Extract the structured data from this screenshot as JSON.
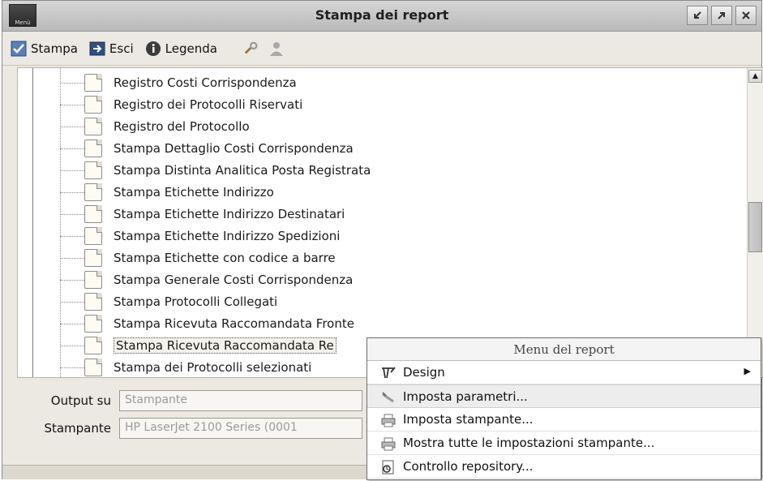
{
  "window": {
    "title": "Stampa dei report",
    "app_icon_text": "Menù",
    "controls": [
      "minimize-icon",
      "maximize-icon",
      "close-icon"
    ]
  },
  "toolbar": {
    "stampa_label": "Stampa",
    "esci_label": "Esci",
    "legenda_label": "Legenda"
  },
  "tree": {
    "items": [
      {
        "label": "Registro Costi Corrispondenza"
      },
      {
        "label": "Registro dei Protocolli Riservati"
      },
      {
        "label": "Registro del Protocollo"
      },
      {
        "label": "Stampa Dettaglio Costi Corrispondenza"
      },
      {
        "label": "Stampa Distinta Analitica Posta Registrata"
      },
      {
        "label": "Stampa Etichette Indirizzo"
      },
      {
        "label": "Stampa Etichette Indirizzo Destinatari"
      },
      {
        "label": "Stampa Etichette Indirizzo Spedizioni"
      },
      {
        "label": "Stampa Etichette con codice a barre"
      },
      {
        "label": "Stampa Generale Costi Corrispondenza"
      },
      {
        "label": "Stampa Protocolli Collegati"
      },
      {
        "label": "Stampa Ricevuta Raccomandata Fronte"
      },
      {
        "label": "Stampa Ricevuta Raccomandata Re"
      },
      {
        "label": "Stampa dei Protocolli selezionati"
      }
    ],
    "selected_index": 12
  },
  "form": {
    "output_label": "Output su",
    "output_value": "Stampante",
    "printer_label": "Stampante",
    "printer_value": "HP LaserJet 2100 Series (0001"
  },
  "context_menu": {
    "title": "Menu del report",
    "items": [
      {
        "label": "Design",
        "icon": "design-icon",
        "submenu": true
      },
      {
        "label": "Imposta parametri...",
        "icon": "parameters-icon",
        "highlighted": true
      },
      {
        "label": "Imposta stampante...",
        "icon": "printer-icon"
      },
      {
        "label": "Mostra tutte le impostazioni stampante...",
        "icon": "printer-settings-icon"
      },
      {
        "label": "Controllo repository...",
        "icon": "repository-icon"
      }
    ]
  }
}
